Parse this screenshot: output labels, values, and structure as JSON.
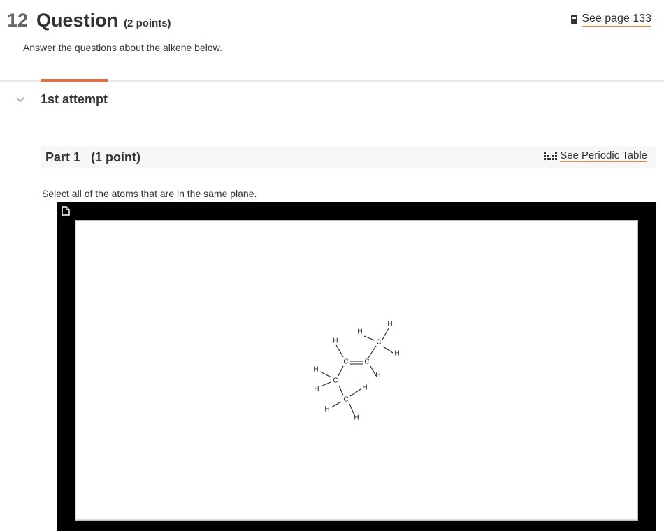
{
  "question": {
    "number": "12",
    "title": "Question",
    "points": "(2 points)",
    "see_page": "See page 133",
    "instructions": "Answer the questions about the alkene below."
  },
  "attempt": {
    "label": "1st attempt"
  },
  "part": {
    "title": "Part 1   (1 point)",
    "periodic_link": "See Periodic Table",
    "prompt": "Select all of the atoms that are in the same plane."
  },
  "molecule": {
    "atoms": {
      "h1": "H",
      "h2": "H",
      "h3": "H",
      "h4": "H",
      "h5": "H",
      "h6": "H",
      "h7": "H",
      "h8": "H",
      "h9": "H",
      "h10": "H",
      "c1": "C",
      "c2": "C",
      "c3": "C",
      "c4": "C",
      "c5": "C"
    }
  },
  "colors": {
    "accent": "#e96a3a",
    "link_underline": "#e98b2e",
    "editor_frame": "#000000"
  }
}
